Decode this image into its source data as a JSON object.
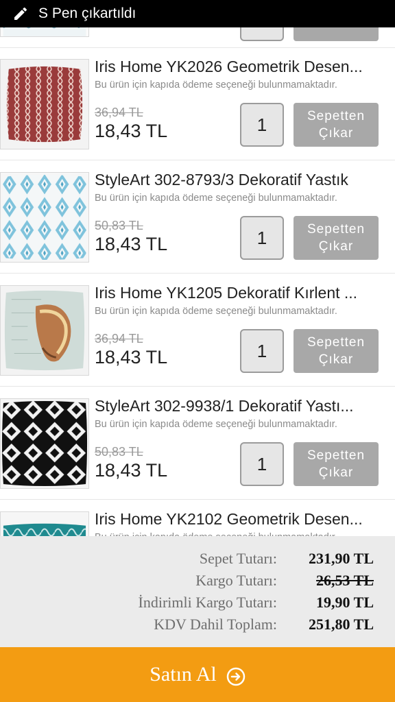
{
  "status_bar": {
    "text": "S Pen çıkartıldı",
    "icon": "pen-icon"
  },
  "labels": {
    "cod_note": "Bu ürün için kapıda ödeme seçeneği bulunmamaktadır.",
    "remove_line1": "Sepetten",
    "remove_line2": "Çıkar"
  },
  "items": [
    {
      "title": "Iris Home YK2026 Geometrik Desen...",
      "old_price": "36,94 TL",
      "price": "18,43 TL",
      "qty": "1",
      "image": "red-trellis-pillow"
    },
    {
      "title": "StyleArt 302-8793/3 Dekoratif Yastık",
      "old_price": "50,83 TL",
      "price": "18,43 TL",
      "qty": "1",
      "image": "blue-ikat-pillow"
    },
    {
      "title": "Iris Home YK1205 Dekoratif Kırlent ...",
      "old_price": "36,94 TL",
      "price": "18,43 TL",
      "qty": "1",
      "image": "seashell-pillow"
    },
    {
      "title": "StyleArt 302-9938/1 Dekoratif Yastı...",
      "old_price": "50,83 TL",
      "price": "18,43 TL",
      "qty": "1",
      "image": "black-diamond-pillow"
    },
    {
      "title": "Iris Home YK2102 Geometrik Desen...",
      "image": "teal-pattern-pillow"
    }
  ],
  "summary": {
    "cart_total_label": "Sepet Tutarı:",
    "cart_total": "231,90 TL",
    "shipping_label": "Kargo Tutarı:",
    "shipping": "26,53 TL",
    "discounted_shipping_label": "İndirimli Kargo Tutarı:",
    "discounted_shipping": "19,90 TL",
    "grand_total_label": "KDV Dahil Toplam:",
    "grand_total": "251,80 TL"
  },
  "buy_button": {
    "label": "Satın Al",
    "icon": "arrow-circle-icon"
  },
  "colors": {
    "accent": "#f39c12",
    "remove_button": "#a8a8a8",
    "summary_bg": "#ebebeb"
  }
}
